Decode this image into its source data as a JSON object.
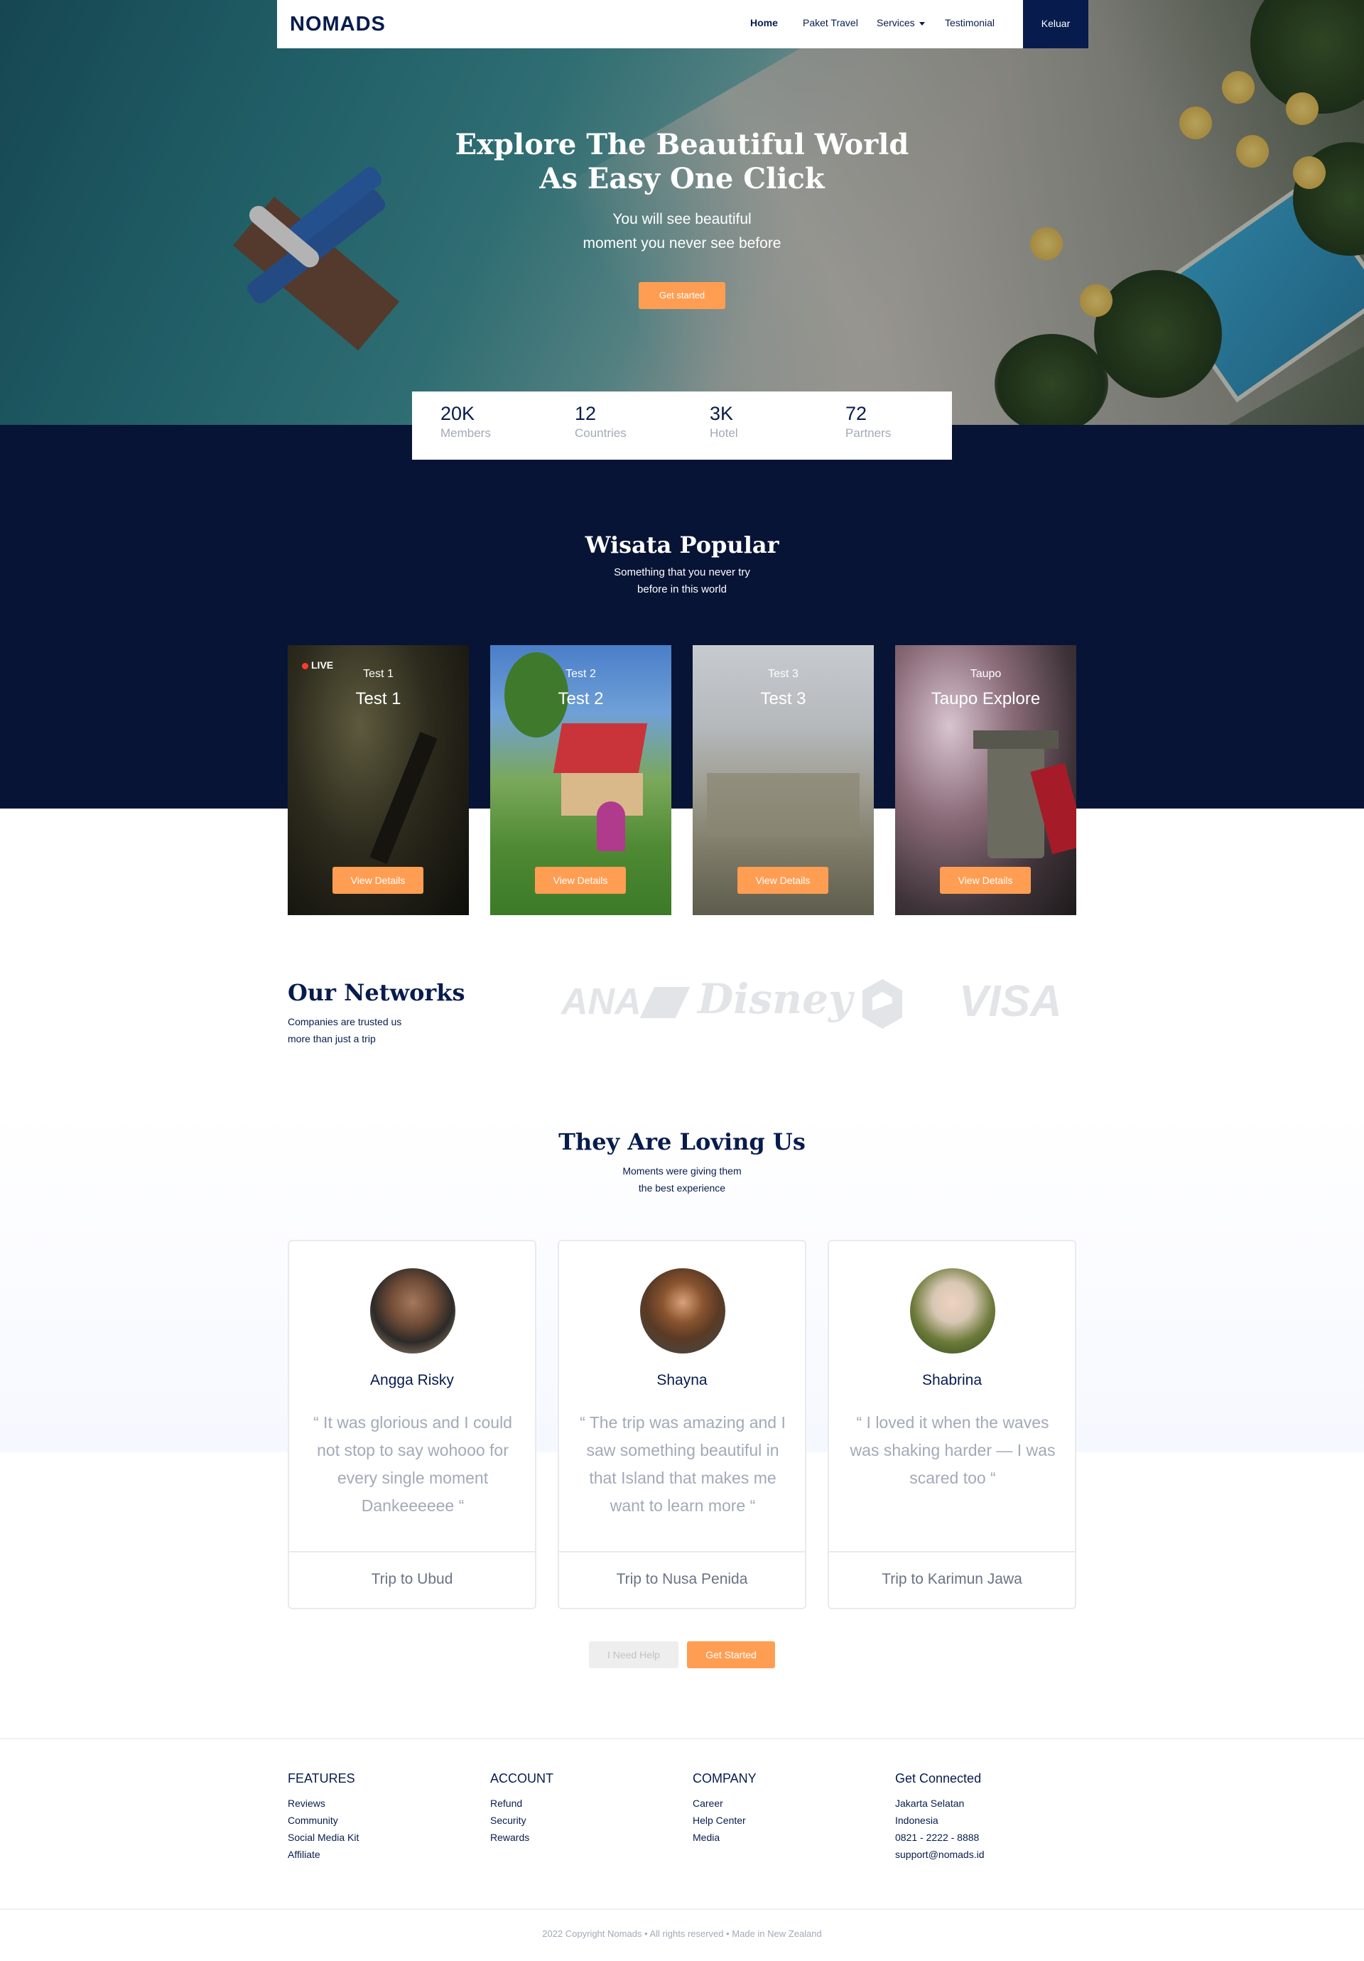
{
  "nav": {
    "brand": "NOMADS",
    "links": [
      "Home",
      "Paket Travel",
      "Services",
      "Testimonial"
    ],
    "logout": "Keluar"
  },
  "hero": {
    "title_line1": "Explore The Beautiful World",
    "title_line2": "As Easy One Click",
    "subtitle_line1": "You will see beautiful",
    "subtitle_line2": "moment you never see before",
    "cta": "Get started"
  },
  "stats": [
    {
      "value": "20K",
      "label": "Members"
    },
    {
      "value": "12",
      "label": "Countries"
    },
    {
      "value": "3K",
      "label": "Hotel"
    },
    {
      "value": "72",
      "label": "Partners"
    }
  ],
  "popular": {
    "title": "Wisata Popular",
    "subtitle_line1": "Something that you never try",
    "subtitle_line2": "before in this world",
    "live_label": "LIVE",
    "cards": [
      {
        "country": "Test 1",
        "location": "Test 1",
        "button": "View Details"
      },
      {
        "country": "Test 2",
        "location": "Test 2",
        "button": "View Details"
      },
      {
        "country": "Test 3",
        "location": "Test 3",
        "button": "View Details"
      },
      {
        "country": "Taupo",
        "location": "Taupo Explore",
        "button": "View Details"
      }
    ]
  },
  "networks": {
    "title": "Our Networks",
    "subtitle_line1": "Companies are trusted us",
    "subtitle_line2": "more than just a trip",
    "logos": [
      "ANA",
      "Disney",
      "VISA"
    ]
  },
  "testimonials": {
    "title": "They Are Loving Us",
    "subtitle_line1": "Moments were giving them",
    "subtitle_line2": "the best experience",
    "items": [
      {
        "name": "Angga Risky",
        "quote": "“ It was glorious and I could not stop to say wohooo for every single moment Dankeeeeee “",
        "trip": "Trip to Ubud"
      },
      {
        "name": "Shayna",
        "quote": "“ The trip was amazing and I saw something beautiful in that Island that makes me want to learn more “",
        "trip": "Trip to Nusa Penida"
      },
      {
        "name": "Shabrina",
        "quote": "“ I loved it when the waves was shaking harder — I was scared too “",
        "trip": "Trip to Karimun Jawa"
      }
    ],
    "help_button": "I Need Help",
    "start_button": "Get Started"
  },
  "footer": {
    "columns": [
      {
        "heading": "FEATURES",
        "items": [
          "Reviews",
          "Community",
          "Social Media Kit",
          "Affiliate"
        ]
      },
      {
        "heading": "ACCOUNT",
        "items": [
          "Refund",
          "Security",
          "Rewards"
        ]
      },
      {
        "heading": "COMPANY",
        "items": [
          "Career",
          "Help Center",
          "Media"
        ]
      },
      {
        "heading": "Get Connected",
        "items": [
          "Jakarta Selatan",
          "Indonesia",
          "0821 - 2222 - 8888",
          "support@nomads.id"
        ]
      }
    ],
    "copyright": "2022 Copyright Nomads • All rights reserved • Made in New Zealand"
  },
  "colors": {
    "navy": "#071C4D",
    "orange": "#FF9E53",
    "dark_band": "#071435",
    "muted": "#A3A9B8"
  }
}
